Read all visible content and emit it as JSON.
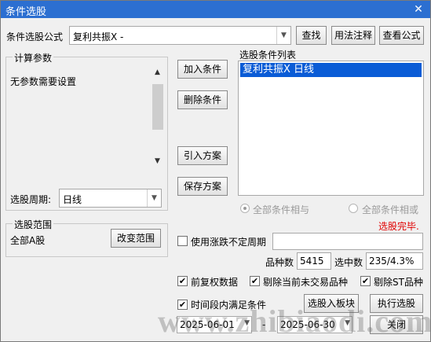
{
  "window": {
    "title": "条件选股",
    "close_glyph": "✕"
  },
  "formula": {
    "label": "条件选股公式",
    "value": "复利共振X  -",
    "find_label": "查找",
    "usage_label": "用法注释",
    "view_label": "查看公式"
  },
  "params": {
    "group_label": "计算参数",
    "text": "无参数需要设置",
    "period_label": "选股周期:",
    "period_value": "日线"
  },
  "actions": {
    "add": "加入条件",
    "delete": "删除条件",
    "import": "引入方案",
    "save": "保存方案"
  },
  "conditions": {
    "label": "选股条件列表",
    "items": [
      "复利共振X  日线"
    ],
    "radio_and": "全部条件相与",
    "radio_or": "全部条件相或",
    "status": "选股完毕.",
    "status_color": "#e00000"
  },
  "range": {
    "group_label": "选股范围",
    "value": "全部A股",
    "change_label": "改变范围"
  },
  "options": {
    "indefinite_period": "使用涨跌不定周期",
    "count_label": "品种数",
    "count_value": "5415",
    "selected_label": "选中数",
    "selected_value": "235/4.3%",
    "pre_adjust": "前复权数据",
    "exclude_untraded": "剔除当前未交易品种",
    "exclude_st": "剔除ST品种",
    "time_range": "时间段内满足条件",
    "date_from": "2025-06-01",
    "date_sep": "-",
    "date_to": "2025-06-30"
  },
  "buttons": {
    "to_block": "选股入板块",
    "execute": "执行选股",
    "close": "关闭"
  },
  "watermark": "www.zhibiaodi.com"
}
